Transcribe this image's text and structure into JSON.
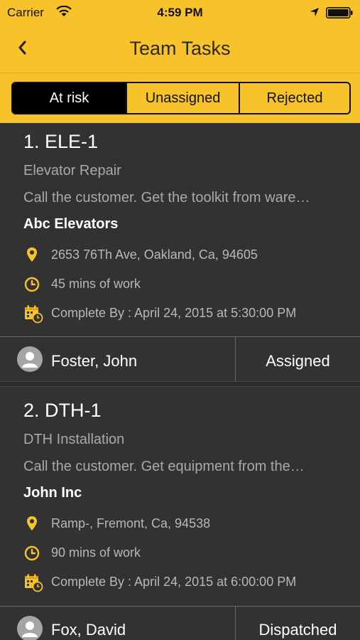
{
  "status_bar": {
    "carrier": "Carrier",
    "time": "4:59 PM"
  },
  "nav": {
    "title": "Team Tasks",
    "back_icon": "chevron-left-icon"
  },
  "tabs": [
    {
      "label": "At risk",
      "active": true
    },
    {
      "label": "Unassigned",
      "active": false
    },
    {
      "label": "Rejected",
      "active": false
    }
  ],
  "colors": {
    "header": "#F8C22B",
    "accent": "#F8C22B",
    "background": "#323232"
  },
  "tasks": [
    {
      "title": "1. ELE-1",
      "type": "Elevator Repair",
      "description": "Call the customer. Get the toolkit from ware…",
      "customer": "Abc Elevators",
      "address": "2653 76Th Ave, Oakland, Ca, 94605",
      "duration": "45 mins of work",
      "complete_by": "Complete By : April 24, 2015 at 5:30:00 PM",
      "assignee": "Foster, John",
      "status": "Assigned"
    },
    {
      "title": "2. DTH-1",
      "type": "DTH Installation",
      "description": "Call the customer. Get equipment from the…",
      "customer": "John Inc",
      "address": "Ramp-, Fremont, Ca, 94538",
      "duration": "90 mins of work",
      "complete_by": "Complete By : April 24, 2015 at 6:00:00 PM",
      "assignee": "Fox, David",
      "status": "Dispatched"
    }
  ]
}
